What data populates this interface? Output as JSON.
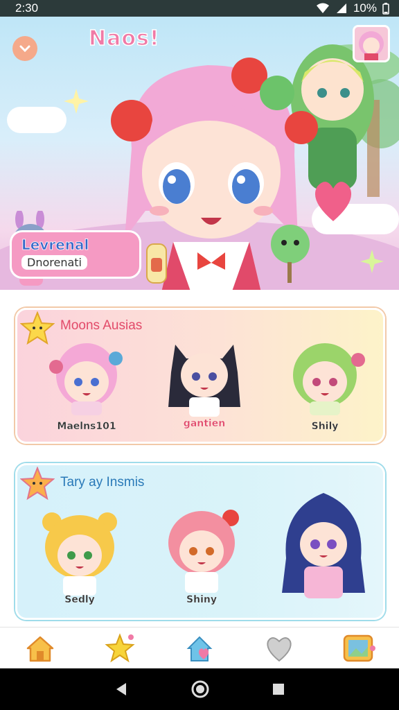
{
  "status_bar": {
    "time": "2:30",
    "battery": "10%"
  },
  "hero": {
    "title": "Naos!",
    "banner_line1": "Levrenal",
    "banner_line2": "Dnorenati"
  },
  "section1": {
    "title": "Moons Ausias",
    "characters": [
      {
        "name": "Maelns101",
        "hair": "#f4a8d6"
      },
      {
        "name": "gantien",
        "hair": "#2a2a3a"
      },
      {
        "name": "Shily",
        "hair": "#9bd46a"
      }
    ]
  },
  "section2": {
    "title": "Tary ay Insmis",
    "characters": [
      {
        "name": "Sedly",
        "hair": "#f7c94a"
      },
      {
        "name": "Shiny",
        "hair": "#f38fa0"
      },
      {
        "name": "",
        "hair": "#2f3f8f"
      }
    ]
  },
  "nav": {
    "items": [
      "home-icon",
      "star-icon",
      "house-heart-icon",
      "heart-icon",
      "gallery-icon"
    ]
  },
  "colors": {
    "accent_pink": "#f07aa6",
    "accent_blue": "#2979b8",
    "status_bg": "#2c3a3a"
  }
}
